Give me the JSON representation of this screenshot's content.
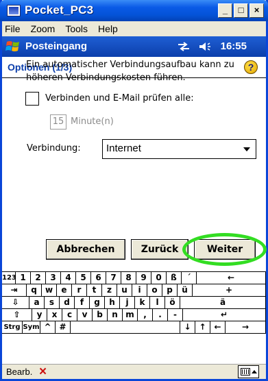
{
  "window": {
    "title": "Pocket_PC3",
    "buttons": [
      "_",
      "□",
      "×"
    ]
  },
  "menu": [
    "File",
    "Zoom",
    "Tools",
    "Help"
  ],
  "nav": {
    "title": "Posteingang",
    "time": "16:55"
  },
  "page": {
    "title": "Optionen (1/3)"
  },
  "content": {
    "warning": "Ein automatischer Verbindungsaufbau kann zu höheren Verbindungskosten führen.",
    "check_label": "Verbinden und E-Mail prüfen alle:",
    "check_checked": false,
    "interval_value": "15",
    "interval_unit": "Minute(n)",
    "connection_label": "Verbindung:",
    "connection_value": "Internet"
  },
  "buttons": {
    "cancel": "Abbrechen",
    "back": "Zurück",
    "next": "Weiter"
  },
  "keyboard": {
    "row1": [
      "123",
      "1",
      "2",
      "3",
      "4",
      "5",
      "6",
      "7",
      "8",
      "9",
      "0",
      "ß",
      "´",
      "←"
    ],
    "row2": [
      "⇥",
      "q",
      "w",
      "e",
      "r",
      "t",
      "z",
      "u",
      "i",
      "o",
      "p",
      "ü",
      "+"
    ],
    "row3": [
      "⇩",
      "a",
      "s",
      "d",
      "f",
      "g",
      "h",
      "j",
      "k",
      "l",
      "ö",
      "ä"
    ],
    "row4": [
      "⇧",
      "y",
      "x",
      "c",
      "v",
      "b",
      "n",
      "m",
      ",",
      ".",
      "-",
      "↵"
    ],
    "row5": [
      "Strg",
      "Sym",
      "^",
      "#",
      "",
      "↓",
      "↑",
      "←",
      "→"
    ]
  },
  "bottom": {
    "edit": "Bearb.",
    "close": "×"
  },
  "colors": {
    "highlight": "#33dd22",
    "nav_blue": "#0b3eab",
    "title_blue": "#0453d8"
  }
}
